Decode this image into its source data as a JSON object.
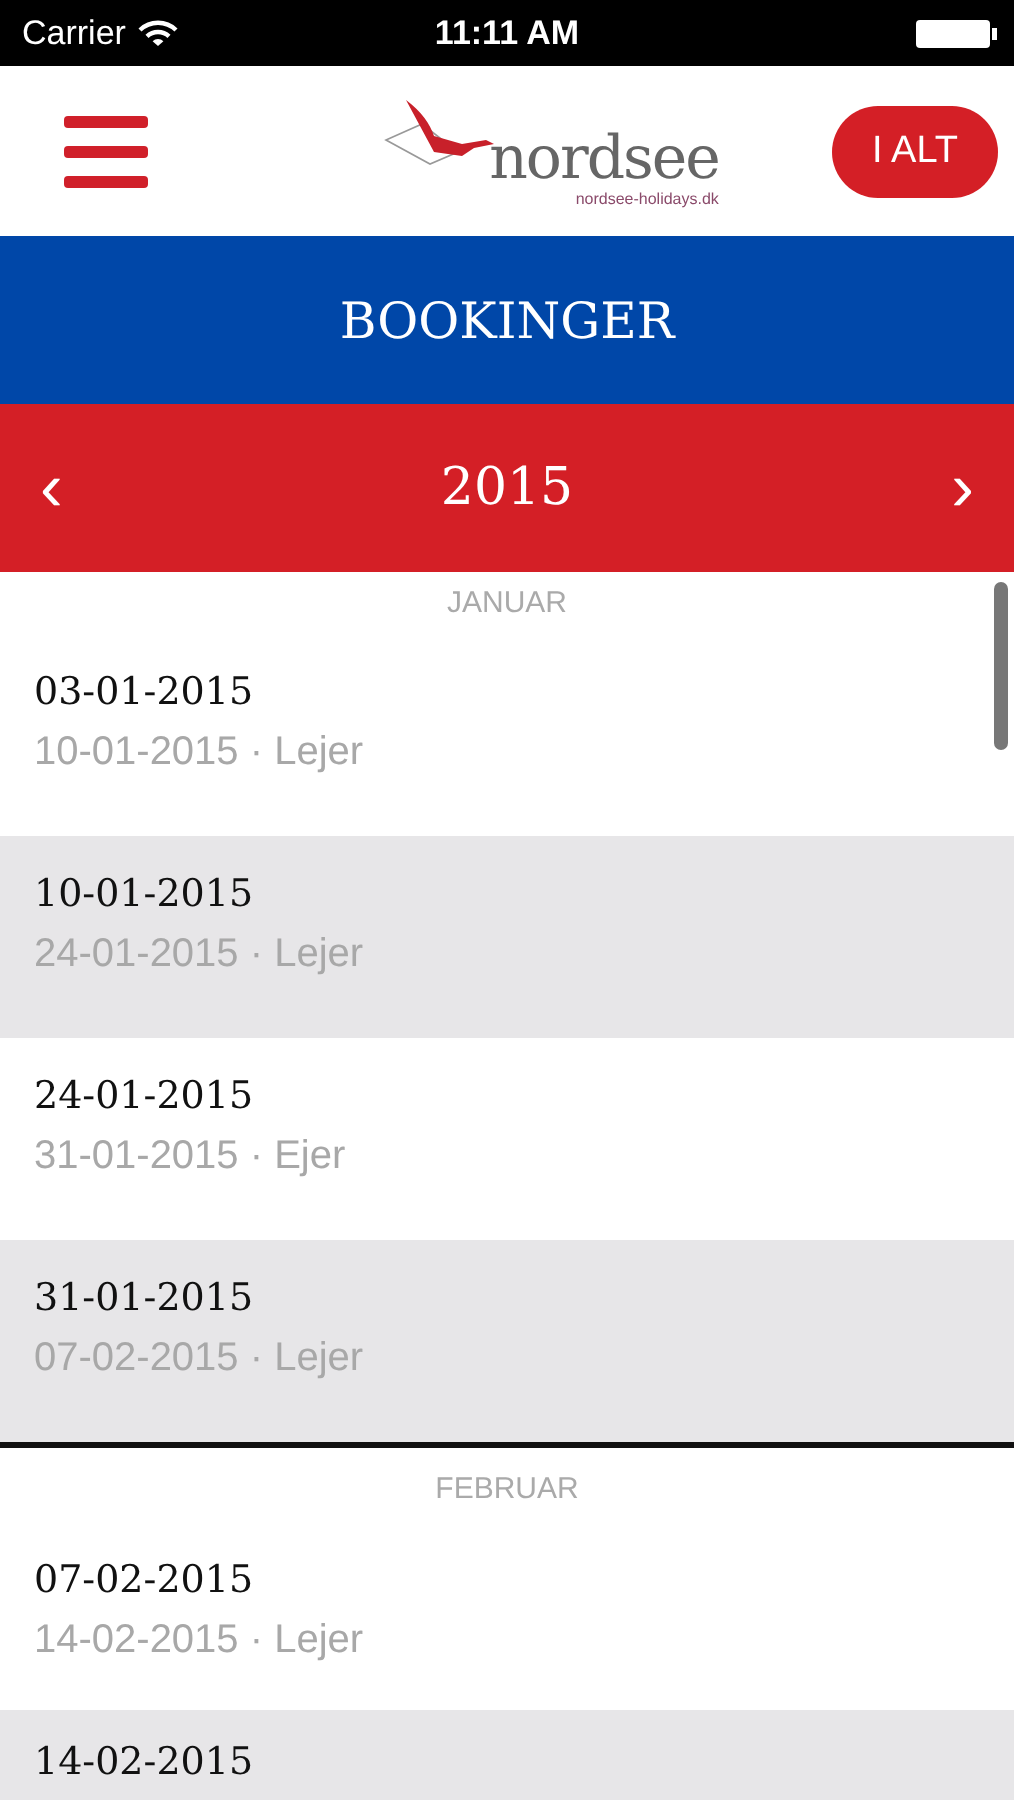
{
  "status_bar": {
    "carrier": "Carrier",
    "time": "11:11 AM"
  },
  "header": {
    "logo_text": "nordsee",
    "logo_subtext": "nordsee-holidays.dk",
    "total_button": "I ALT"
  },
  "title": "BOOKINGER",
  "year_nav": {
    "prev": "‹",
    "year": "2015",
    "next": "›"
  },
  "sections": [
    {
      "month": "JANUAR",
      "bookings": [
        {
          "date": "03-01-2015",
          "detail": "10-01-2015 · Lejer"
        },
        {
          "date": "10-01-2015",
          "detail": "24-01-2015 · Lejer"
        },
        {
          "date": "24-01-2015",
          "detail": "31-01-2015 · Ejer"
        },
        {
          "date": "31-01-2015",
          "detail": "07-02-2015 · Lejer"
        }
      ]
    },
    {
      "month": "FEBRUAR",
      "bookings": [
        {
          "date": "07-02-2015",
          "detail": "14-02-2015 · Lejer"
        },
        {
          "date": "14-02-2015"
        }
      ]
    }
  ]
}
